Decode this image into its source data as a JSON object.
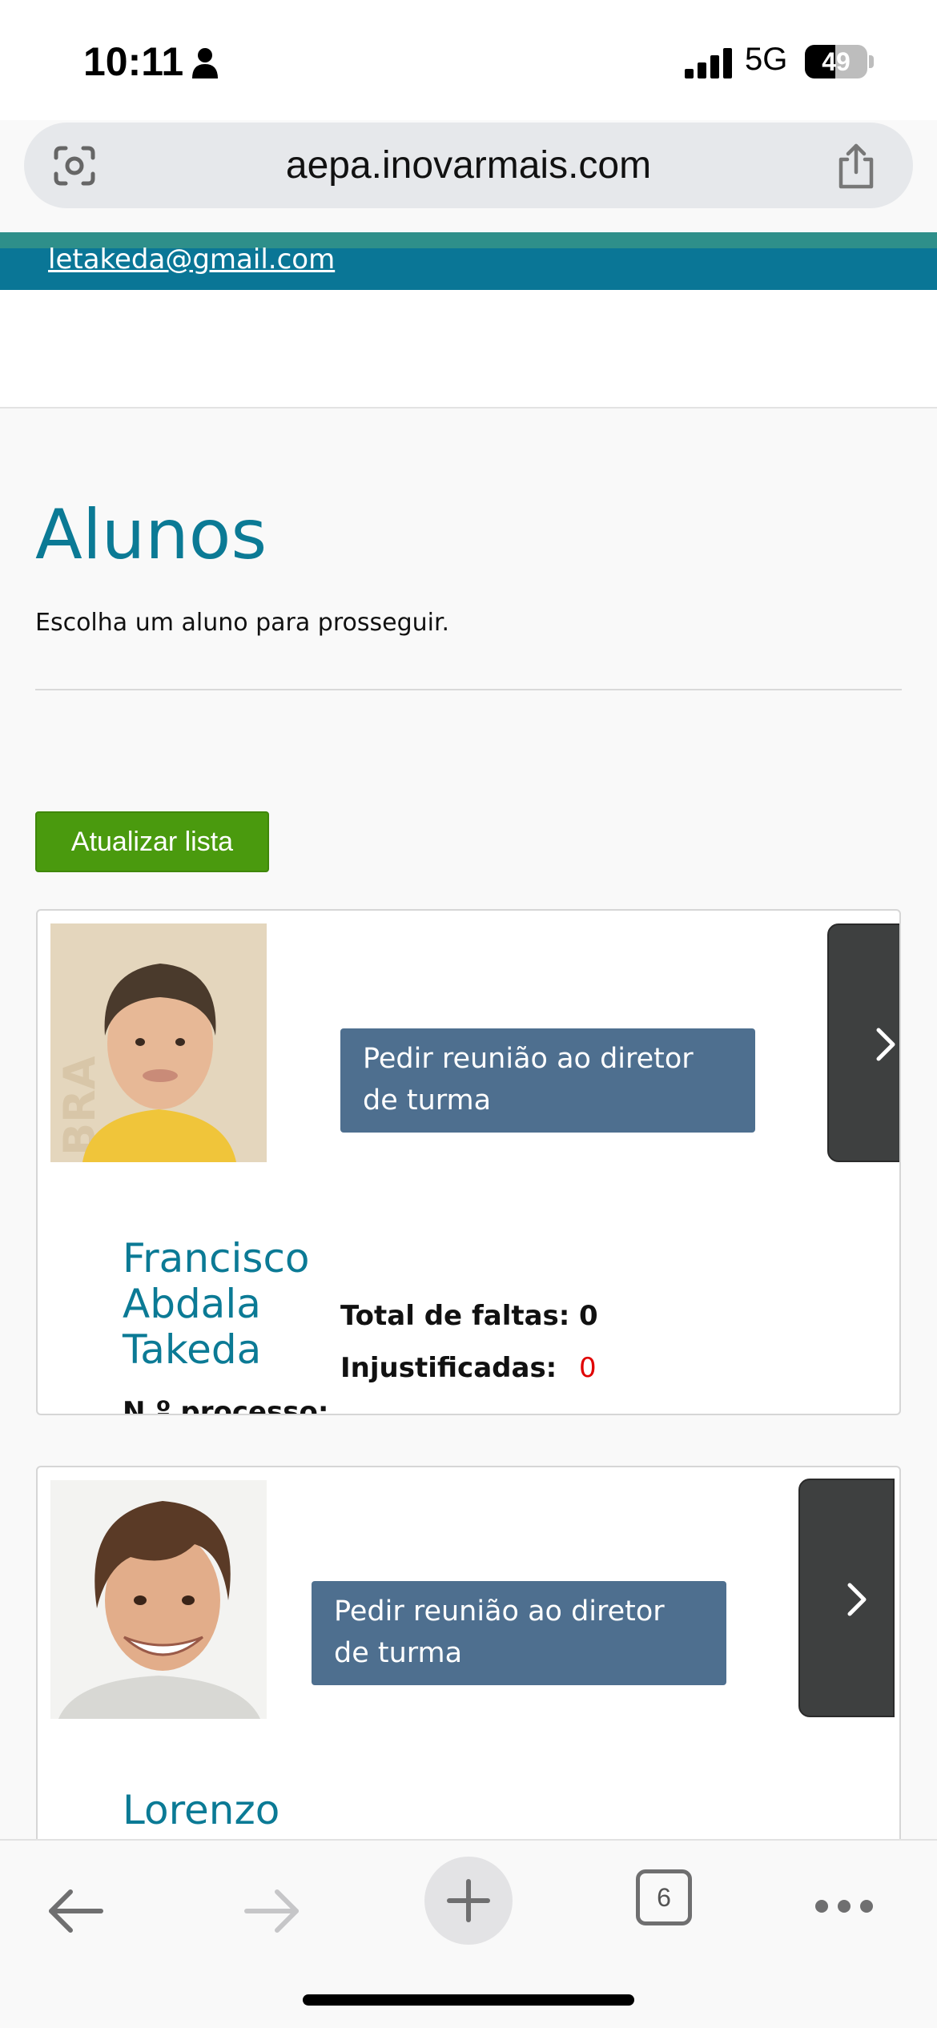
{
  "status_bar": {
    "time": "10:11",
    "network": "5G",
    "battery_percent": 49,
    "battery_label": "49",
    "icons": [
      "person-icon",
      "signal-icon",
      "battery-icon"
    ]
  },
  "browser": {
    "url": "aepa.inovarmais.com",
    "tabs_count": "6",
    "icons": [
      "visual-search-icon",
      "share-icon",
      "back-arrow-icon",
      "forward-arrow-icon",
      "plus-icon",
      "more-icon"
    ]
  },
  "header": {
    "email": "letakeda@gmail.com"
  },
  "page": {
    "title": "Alunos",
    "subtitle": "Escolha um aluno para prosseguir.",
    "refresh_label": "Atualizar lista"
  },
  "students": [
    {
      "name": "Francisco Abdala Takeda",
      "meeting_label": "Pedir reunião ao diretor de turma",
      "process_label": "N.º processo:",
      "total_absences_label": "Total de faltas:",
      "total_absences": "0",
      "unjustified_label": "Injustificadas:",
      "unjustified": "0"
    },
    {
      "name": "Lorenzo",
      "meeting_label": "Pedir reunião ao diretor de turma"
    }
  ],
  "colors": {
    "accent": "#0b7a95",
    "header_teal": "#0a7696",
    "button_green": "#4a9a0e",
    "button_slate": "#4e6f8f",
    "alert_red": "#e00000"
  }
}
